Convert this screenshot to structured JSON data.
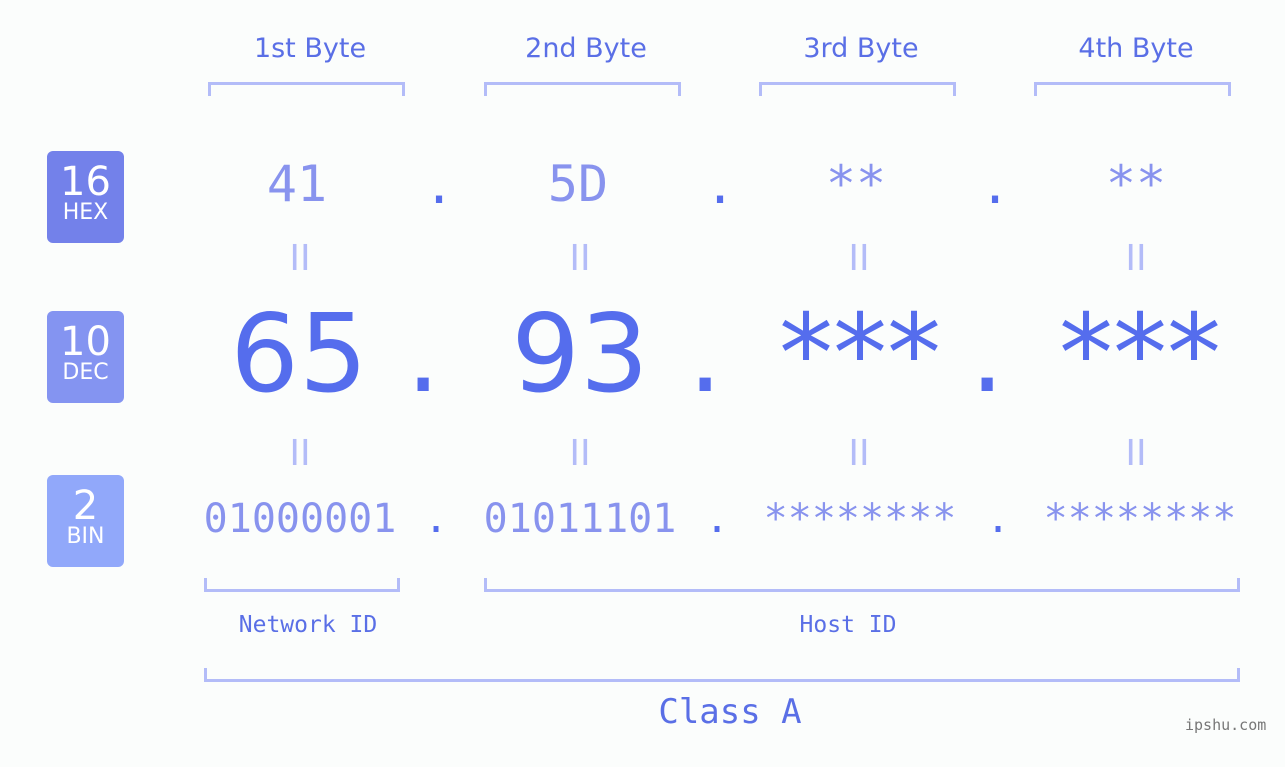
{
  "byte_headers": [
    "1st Byte",
    "2nd Byte",
    "3rd Byte",
    "4th Byte"
  ],
  "badges": [
    {
      "num": "16",
      "label": "HEX",
      "color": "#7381ea"
    },
    {
      "num": "10",
      "label": "DEC",
      "color": "#8494f1"
    },
    {
      "num": "2",
      "label": "BIN",
      "color": "#91a8fa"
    }
  ],
  "hex": [
    "41",
    "5D",
    "**",
    "**"
  ],
  "dec": [
    "65",
    "93",
    "***",
    "***"
  ],
  "bin": [
    "01000001",
    "01011101",
    "********",
    "********"
  ],
  "separator": ".",
  "equals": "II",
  "network_label": "Network ID",
  "host_label": "Host ID",
  "class_label": "Class A",
  "footer": "ipshu.com"
}
